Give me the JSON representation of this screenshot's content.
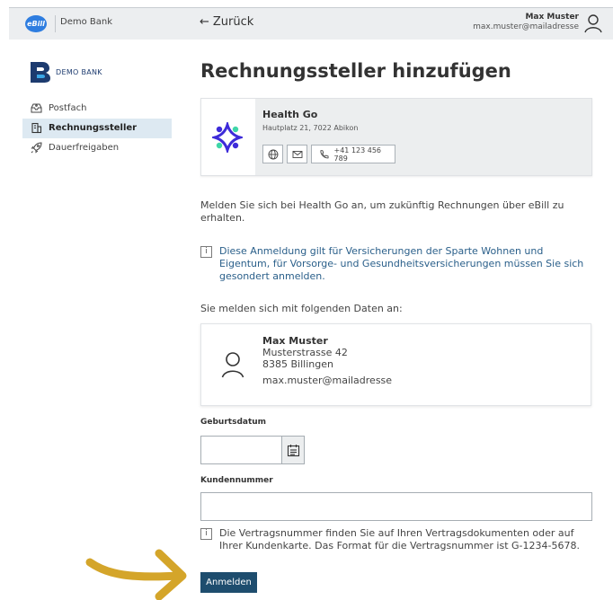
{
  "topbar": {
    "ebill_logo": "eBill",
    "brand": "Demo Bank",
    "back_label": "Zurück",
    "user_name": "Max Muster",
    "user_email": "max.muster@mailadresse"
  },
  "sidebar": {
    "brand": "DEMO BANK",
    "items": [
      {
        "label": "Postfach",
        "icon": "inbox-icon",
        "active": false
      },
      {
        "label": "Rechnungssteller",
        "icon": "building-icon",
        "active": true
      },
      {
        "label": "Dauerfreigaben",
        "icon": "rocket-icon",
        "active": false
      }
    ]
  },
  "main": {
    "title": "Rechnungssteller hinzufügen",
    "biller": {
      "name": "Health Go",
      "address": "Hautplatz 21, 7022 Abikon",
      "phone": "+41 123 456 789"
    },
    "intro": "Melden Sie sich bei Health Go an, um zukünftig Rechnungen über eBill zu erhalten.",
    "info_icon": "i",
    "notice": "Diese Anmeldung gilt für Versicherungen der Sparte Wohnen und Eigentum, für Vorsorge- und Gesundheitsversicherungen müssen Sie sich gesondert anmelden.",
    "data_label": "Sie melden sich mit folgenden Daten an:",
    "person": {
      "name": "Max Muster",
      "street": "Musterstrasse 42",
      "city": "8385 Billingen",
      "email": "max.muster@mailadresse"
    },
    "birthdate_label": "Geburtsdatum",
    "birthdate_value": "",
    "customer_no_label": "Kundennummer",
    "customer_no_value": "",
    "customer_no_hint": "Die Vertragsnummer finden Sie auf Ihren Vertragsdokumenten oder auf Ihrer Kundenkarte. Das Format für die Vertragsnummer ist G-1234-5678.",
    "submit_label": "Anmelden"
  },
  "colors": {
    "primary": "#1e4d6e",
    "active_nav": "#dde9f2",
    "notice_text": "#2a5f8a",
    "arrow": "#d4a52a",
    "ebill_blue": "#2e7de0"
  }
}
